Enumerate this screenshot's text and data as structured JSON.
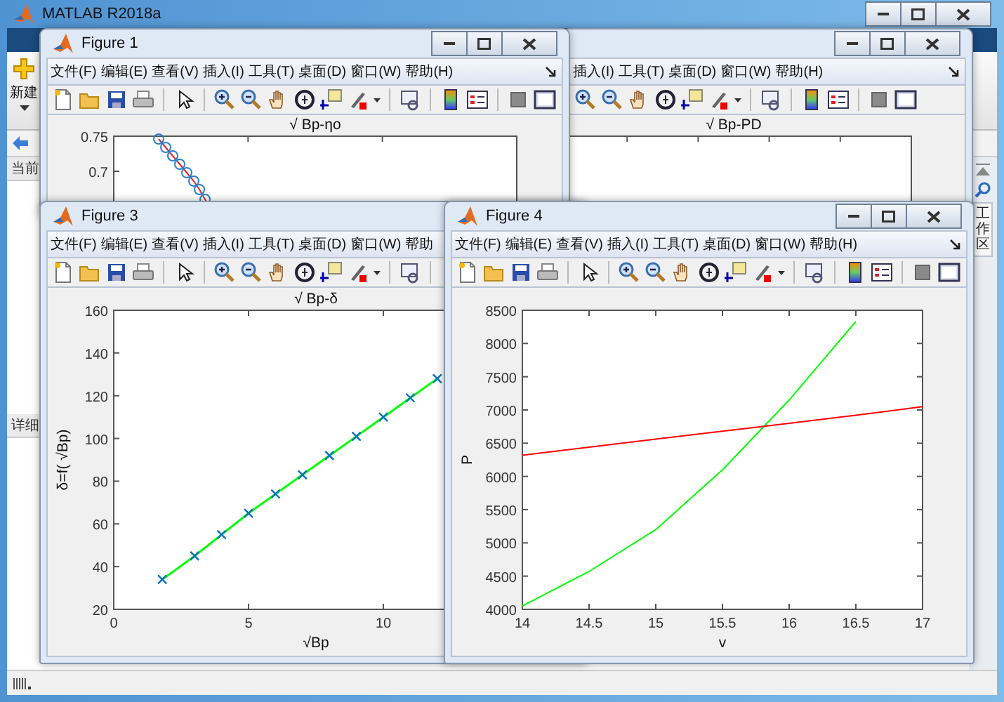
{
  "main_window": {
    "title": "MATLAB R2018a",
    "new_button": "新建",
    "current_folder_label": "当前",
    "details_label": "详细",
    "workspace_tab": "工作区"
  },
  "figures": [
    {
      "title": "Figure 1",
      "menu": [
        "文件(F)",
        "编辑(E)",
        "查看(V)",
        "插入(I)",
        "工具(T)",
        "桌面(D)",
        "窗口(W)",
        "帮助(H)"
      ],
      "plot": {
        "title": "√ Bp-ηo",
        "ytick_labels": [
          "0.75",
          "0.7"
        ]
      }
    },
    {
      "menu": [
        "插入(I)",
        "工具(T)",
        "桌面(D)",
        "窗口(W)",
        "帮助(H)"
      ],
      "plot": {
        "title": "√ Bp-PD"
      }
    },
    {
      "title": "Figure 3",
      "menu": [
        "文件(F)",
        "编辑(E)",
        "查看(V)",
        "插入(I)",
        "工具(T)",
        "桌面(D)",
        "窗口(W)",
        "帮助"
      ],
      "plot": {
        "chart_data": {
          "type": "line",
          "title": "√ Bp-δ",
          "xlabel": "√Bp",
          "ylabel": "δ=f( √Bp)",
          "x": [
            1.8,
            3,
            4,
            5,
            6,
            7,
            8,
            9,
            10,
            11,
            12
          ],
          "series": [
            {
              "color": "#00ff00",
              "marker": "x",
              "values": [
                34,
                45,
                55,
                65,
                74,
                83,
                92,
                101,
                110,
                119,
                128
              ]
            }
          ],
          "xlim": [
            0,
            15
          ],
          "ylim": [
            20,
            160
          ],
          "xticks": [
            0,
            5,
            10
          ],
          "yticks": [
            20,
            40,
            60,
            80,
            100,
            120,
            140,
            160
          ]
        }
      }
    },
    {
      "title": "Figure 4",
      "menu": [
        "文件(F)",
        "编辑(E)",
        "查看(V)",
        "插入(I)",
        "工具(T)",
        "桌面(D)",
        "窗口(W)",
        "帮助(H)"
      ],
      "plot": {
        "chart_data": {
          "type": "line",
          "xlabel": "v",
          "ylabel": "P",
          "x": [
            14,
            14.5,
            15,
            15.5,
            16,
            16.5,
            17
          ],
          "series": [
            {
              "color": "#00ff00",
              "values": [
                4050,
                4570,
                5200,
                6100,
                7150,
                8330,
                null
              ]
            },
            {
              "color": "#ff0000",
              "values": [
                6320,
                6440,
                6560,
                6680,
                6800,
                6920,
                7050
              ]
            }
          ],
          "xlim": [
            14,
            17
          ],
          "ylim": [
            4000,
            8500
          ],
          "xticks": [
            14,
            14.5,
            15,
            15.5,
            16,
            16.5,
            17
          ],
          "yticks": [
            4000,
            4500,
            5000,
            5500,
            6000,
            6500,
            7000,
            7500,
            8000,
            8500
          ]
        }
      }
    }
  ]
}
